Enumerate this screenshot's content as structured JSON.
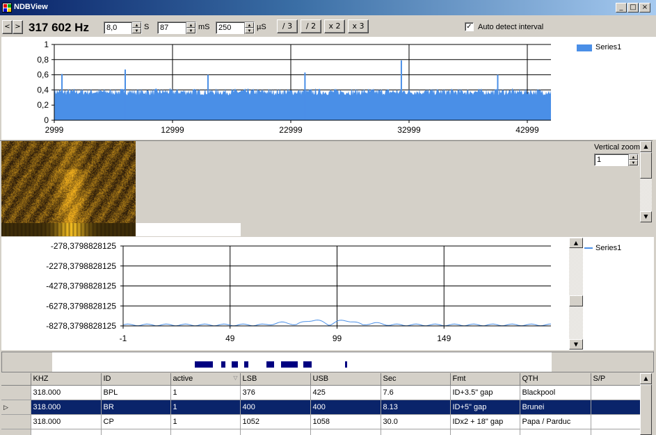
{
  "window": {
    "title": "NDBView"
  },
  "toolbar": {
    "frequency": "317 602 Hz",
    "seconds_value": "8,0",
    "seconds_unit": "S",
    "ms_value": "87",
    "ms_unit": "mS",
    "us_value": "250",
    "us_unit": "µS",
    "div3_label": "/ 3",
    "div2_label": "/ 2",
    "x2_label": "x 2",
    "x3_label": "x 3",
    "auto_detect_label": "Auto detect interval",
    "auto_detect_checked": true
  },
  "chart_data": [
    {
      "type": "bar",
      "ylim": [
        0,
        1
      ],
      "yticks": [
        "1",
        "0,8",
        "0,6",
        "0,4",
        "0,2",
        "0"
      ],
      "xticks": [
        "2999",
        "12999",
        "22999",
        "32999",
        "42999"
      ],
      "x_range": [
        2999,
        45000
      ],
      "baseline": 0.38,
      "peaks": [
        {
          "x": 3650,
          "y": 0.61
        },
        {
          "x": 8999,
          "y": 0.67
        },
        {
          "x": 15999,
          "y": 0.6
        },
        {
          "x": 24199,
          "y": 0.63
        },
        {
          "x": 32349,
          "y": 0.79
        },
        {
          "x": 40499,
          "y": 0.6
        }
      ],
      "legend": [
        "Series1"
      ],
      "legend_color": "#4a8fe7",
      "grid": true
    },
    {
      "type": "line",
      "yticks": [
        "-278,3798828125",
        "-2278,3798828125",
        "-4278,3798828125",
        "-6278,3798828125",
        "-8278,3798828125"
      ],
      "xticks": [
        "-1",
        "49",
        "99",
        "149"
      ],
      "ylim": [
        -8278.3798828125,
        -278.3798828125
      ],
      "xlim": [
        -1,
        199
      ],
      "legend": [
        "Series1"
      ],
      "legend_color": "#4a8fe7",
      "grid": true
    }
  ],
  "vertical_zoom": {
    "label": "Vertical zoom",
    "value": "1"
  },
  "table": {
    "columns": [
      "KHZ",
      "ID",
      "active",
      "LSB",
      "USB",
      "Sec",
      "Fmt",
      "QTH",
      "S/P"
    ],
    "rows": [
      [
        "318.000",
        "BPL",
        "1",
        "376",
        "425",
        "7.6",
        "ID+3.5\" gap",
        "Blackpool",
        ""
      ],
      [
        "318.000",
        "BR",
        "1",
        "400",
        "400",
        "8.13",
        "ID+5\" gap",
        "Brunei",
        ""
      ],
      [
        "318.000",
        "CP",
        "1",
        "1052",
        "1058",
        "30.0",
        "IDx2 + 18\" gap",
        "Papa / Parduc",
        ""
      ]
    ],
    "selected_row": 1
  }
}
